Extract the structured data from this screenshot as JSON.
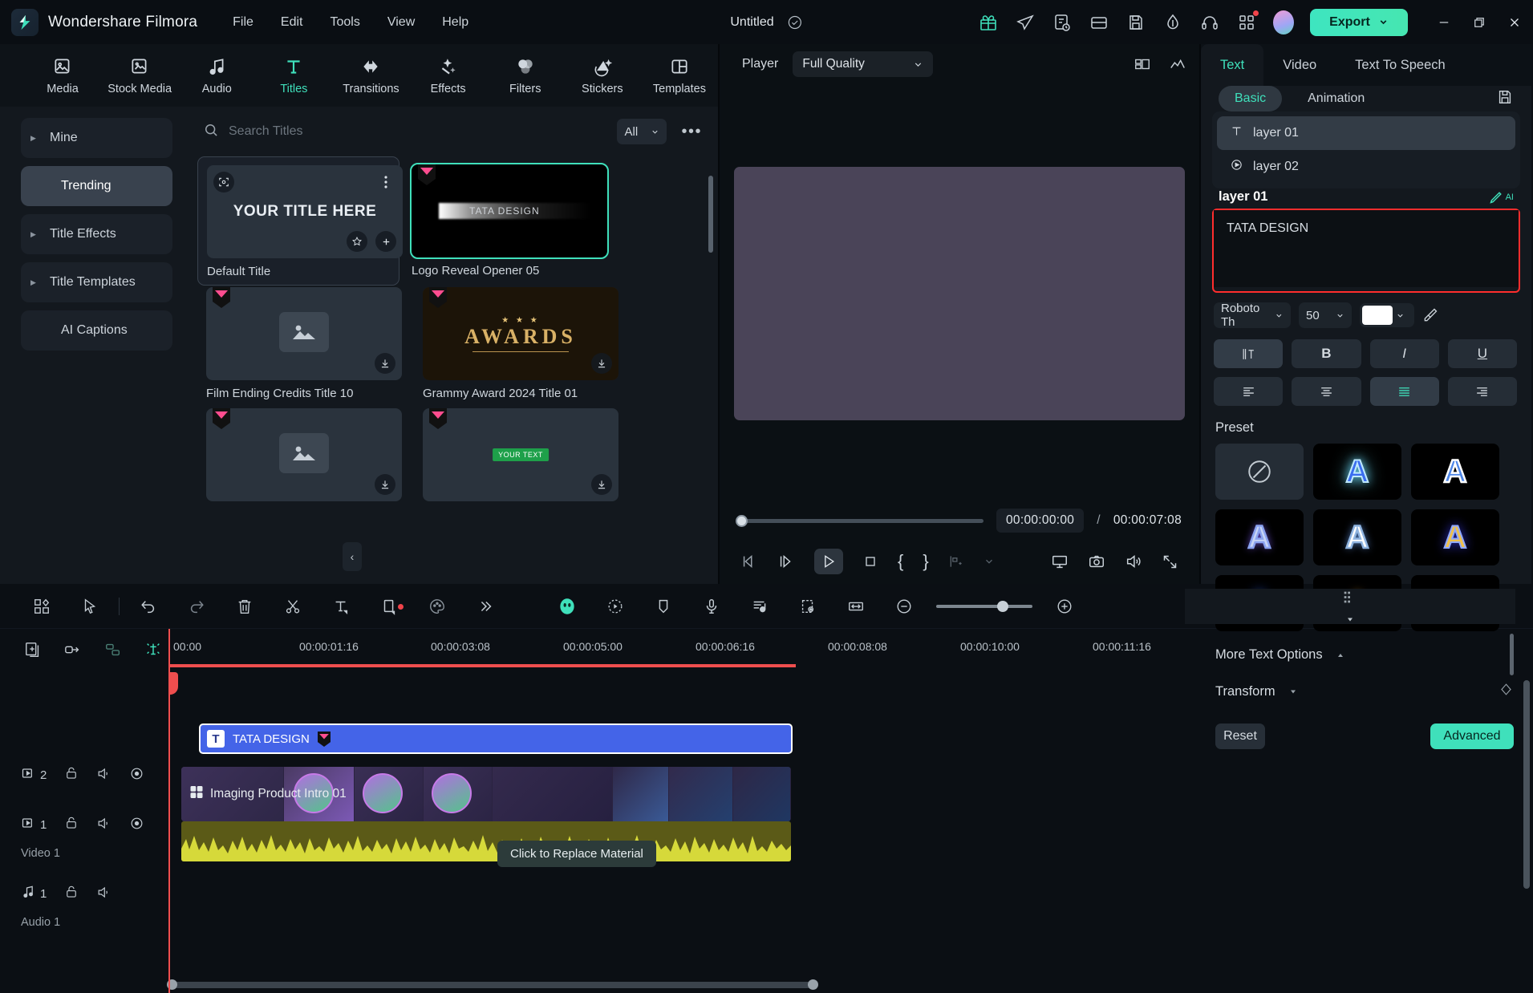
{
  "titlebar": {
    "brand": "Wondershare Filmora",
    "menu": [
      "File",
      "Edit",
      "Tools",
      "View",
      "Help"
    ],
    "document_title": "Untitled",
    "export_label": "Export",
    "icons": [
      "check-circle-icon",
      "gift-icon",
      "send-icon",
      "notes-icon",
      "panel-icon",
      "save-icon",
      "drop-icon",
      "headset-icon",
      "apps-icon"
    ],
    "window_controls": [
      "minimize-icon",
      "restore-icon",
      "close-icon"
    ],
    "accent": "#3fe0bb"
  },
  "library": {
    "categories": [
      {
        "label": "Media",
        "icon": "media-icon",
        "active": false
      },
      {
        "label": "Stock Media",
        "icon": "stock-media-icon",
        "active": false
      },
      {
        "label": "Audio",
        "icon": "audio-icon",
        "active": false
      },
      {
        "label": "Titles",
        "icon": "titles-icon",
        "active": true
      },
      {
        "label": "Transitions",
        "icon": "transitions-icon",
        "active": false
      },
      {
        "label": "Effects",
        "icon": "effects-icon",
        "active": false
      },
      {
        "label": "Filters",
        "icon": "filters-icon",
        "active": false
      },
      {
        "label": "Stickers",
        "icon": "stickers-icon",
        "active": false
      },
      {
        "label": "Templates",
        "icon": "templates-icon",
        "active": false
      }
    ],
    "sidebar": [
      {
        "label": "Mine",
        "expandable": true,
        "active": false
      },
      {
        "label": "Trending",
        "expandable": false,
        "active": true
      },
      {
        "label": "Title Effects",
        "expandable": true,
        "active": false
      },
      {
        "label": "Title Templates",
        "expandable": true,
        "active": false
      },
      {
        "label": "AI Captions",
        "expandable": false,
        "active": false
      }
    ],
    "search_placeholder": "Search Titles",
    "filter_label": "All",
    "tiles": [
      {
        "caption": "Default Title",
        "kind": "default",
        "preview_text": "YOUR TITLE HERE",
        "premium": false,
        "selected_box": true
      },
      {
        "caption": "Logo Reveal Opener 05",
        "kind": "logo-reveal",
        "preview_text": "TATA DESIGN",
        "premium": true,
        "selected": true
      },
      {
        "caption": "Film Ending Credits Title 10",
        "kind": "placeholder",
        "premium": true,
        "download": true
      },
      {
        "caption": "Grammy Award 2024 Title 01",
        "kind": "awards",
        "preview_text": "AWARDS",
        "premium": true,
        "download": true
      },
      {
        "caption": "",
        "kind": "placeholder",
        "premium": true,
        "download": true
      },
      {
        "caption": "",
        "kind": "yourtext",
        "preview_text": "YOUR TEXT",
        "premium": true,
        "download": true
      }
    ]
  },
  "player": {
    "label": "Player",
    "quality": "Full Quality",
    "current_time": "00:00:00:00",
    "separator": "/",
    "total_time": "00:00:07:08",
    "controls": [
      "prev-frame-icon",
      "next-frame-icon",
      "play-icon",
      "stop-icon",
      "mark-in-icon",
      "mark-out-icon",
      "split-icon",
      "chevron-down-icon",
      "display-icon",
      "snapshot-icon",
      "volume-icon",
      "fullscreen-icon"
    ],
    "header_icons": [
      "grid-view-icon",
      "scope-icon"
    ]
  },
  "properties": {
    "tabs": [
      {
        "label": "Text",
        "active": true
      },
      {
        "label": "Video",
        "active": false
      },
      {
        "label": "Text To Speech",
        "active": false
      }
    ],
    "subtabs": [
      {
        "label": "Basic",
        "active": true
      },
      {
        "label": "Animation",
        "active": false
      }
    ],
    "save_icon": "save-preset-icon",
    "layers": [
      {
        "label": "layer 01",
        "icon": "text-layer-icon",
        "selected": true
      },
      {
        "label": "layer 02",
        "icon": "play-layer-icon",
        "selected": false
      }
    ],
    "layer_title": "layer 01",
    "ai_badge": "AI",
    "text_value": "TATA DESIGN",
    "font_family": "Roboto Th",
    "font_size": "50",
    "font_color": "#ffffff",
    "color_picker_icon": "eyedropper-icon",
    "style_buttons": [
      {
        "name": "spacing-icon",
        "label": "",
        "active": true
      },
      {
        "name": "bold-icon",
        "label": "B",
        "active": false
      },
      {
        "name": "italic-icon",
        "label": "I",
        "active": false
      },
      {
        "name": "underline-icon",
        "label": "U",
        "active": false
      }
    ],
    "align_buttons": [
      {
        "name": "align-left-icon",
        "active": false
      },
      {
        "name": "align-center-icon",
        "active": false
      },
      {
        "name": "align-justify-icon",
        "active": true
      },
      {
        "name": "align-right-icon",
        "active": false
      }
    ],
    "preset_label": "Preset",
    "presets": [
      {
        "type": "none"
      },
      {
        "type": "A",
        "fill": "#3a6df0",
        "glow": "#6fe0ff",
        "stroke": "#bfe9ff"
      },
      {
        "type": "A",
        "fill": "#4d86e8",
        "glow": "#000000",
        "stroke": "#ffffff"
      },
      {
        "type": "A",
        "fill": "#c8d5f5",
        "glow": "#7b5cf0",
        "stroke": "#8aa2f0"
      },
      {
        "type": "A",
        "fill": "#ffffff",
        "glow": "#5e8fd8",
        "stroke": "#8fb4e0"
      },
      {
        "type": "A",
        "fill": "#f0c14b",
        "glow": "#3a3af0",
        "stroke": "#8fa8ff"
      },
      {
        "type": "A",
        "fill": "#f0c14b",
        "glow": "#2a5ce8",
        "stroke": "#ffffff"
      },
      {
        "type": "A",
        "fill": "#f0b840",
        "glow": "#8a5a10",
        "stroke": "#ffd98a"
      },
      {
        "type": "A",
        "fill": "#f2d14a",
        "glow": "#000000",
        "stroke": "#ffffff"
      }
    ],
    "more_text_options": "More Text Options",
    "transform": "Transform",
    "reset_label": "Reset",
    "advanced_label": "Advanced"
  },
  "timeline": {
    "toolbar_left": [
      "templates-icon",
      "select-tool-icon",
      "undo-icon",
      "redo-icon",
      "delete-icon",
      "cut-icon",
      "text-tool-icon",
      "crop-tool-icon",
      "color-tool-icon",
      "more-icon"
    ],
    "toolbar_center": [
      "ai-mask-icon",
      "motion-tracking-icon",
      "marker-icon",
      "voiceover-icon",
      "beat-detect-icon",
      "render-preview-icon",
      "fit-timeline-icon",
      "zoom-out-icon",
      "zoom-in-icon"
    ],
    "toolbar_right": [
      "track-manager-icon",
      "chevron-down-icon"
    ],
    "head_icons": [
      "add-track-icon",
      "link-icon",
      "group-icon",
      "magnet-icon"
    ],
    "ruler_labels": [
      "00:00",
      "00:00:01:16",
      "00:00:03:08",
      "00:00:05:00",
      "00:00:06:16",
      "00:00:08:08",
      "00:00:10:00",
      "00:00:11:16"
    ],
    "tracks": [
      {
        "num": "2",
        "type": "video",
        "label": "",
        "icons": [
          "video-track-icon",
          "lock-icon",
          "mute-icon",
          "eye-icon"
        ]
      },
      {
        "num": "1",
        "type": "video",
        "label": "Video 1",
        "icons": [
          "video-track-icon",
          "lock-icon",
          "mute-icon",
          "eye-icon"
        ]
      },
      {
        "num": "1",
        "type": "audio",
        "label": "Audio 1",
        "icons": [
          "audio-track-icon",
          "lock-icon",
          "mute-icon"
        ]
      }
    ],
    "clips": {
      "text_clip": "TATA DESIGN",
      "video_clip": "Imaging Product Intro 01"
    },
    "tooltip": "Click to Replace Material"
  }
}
